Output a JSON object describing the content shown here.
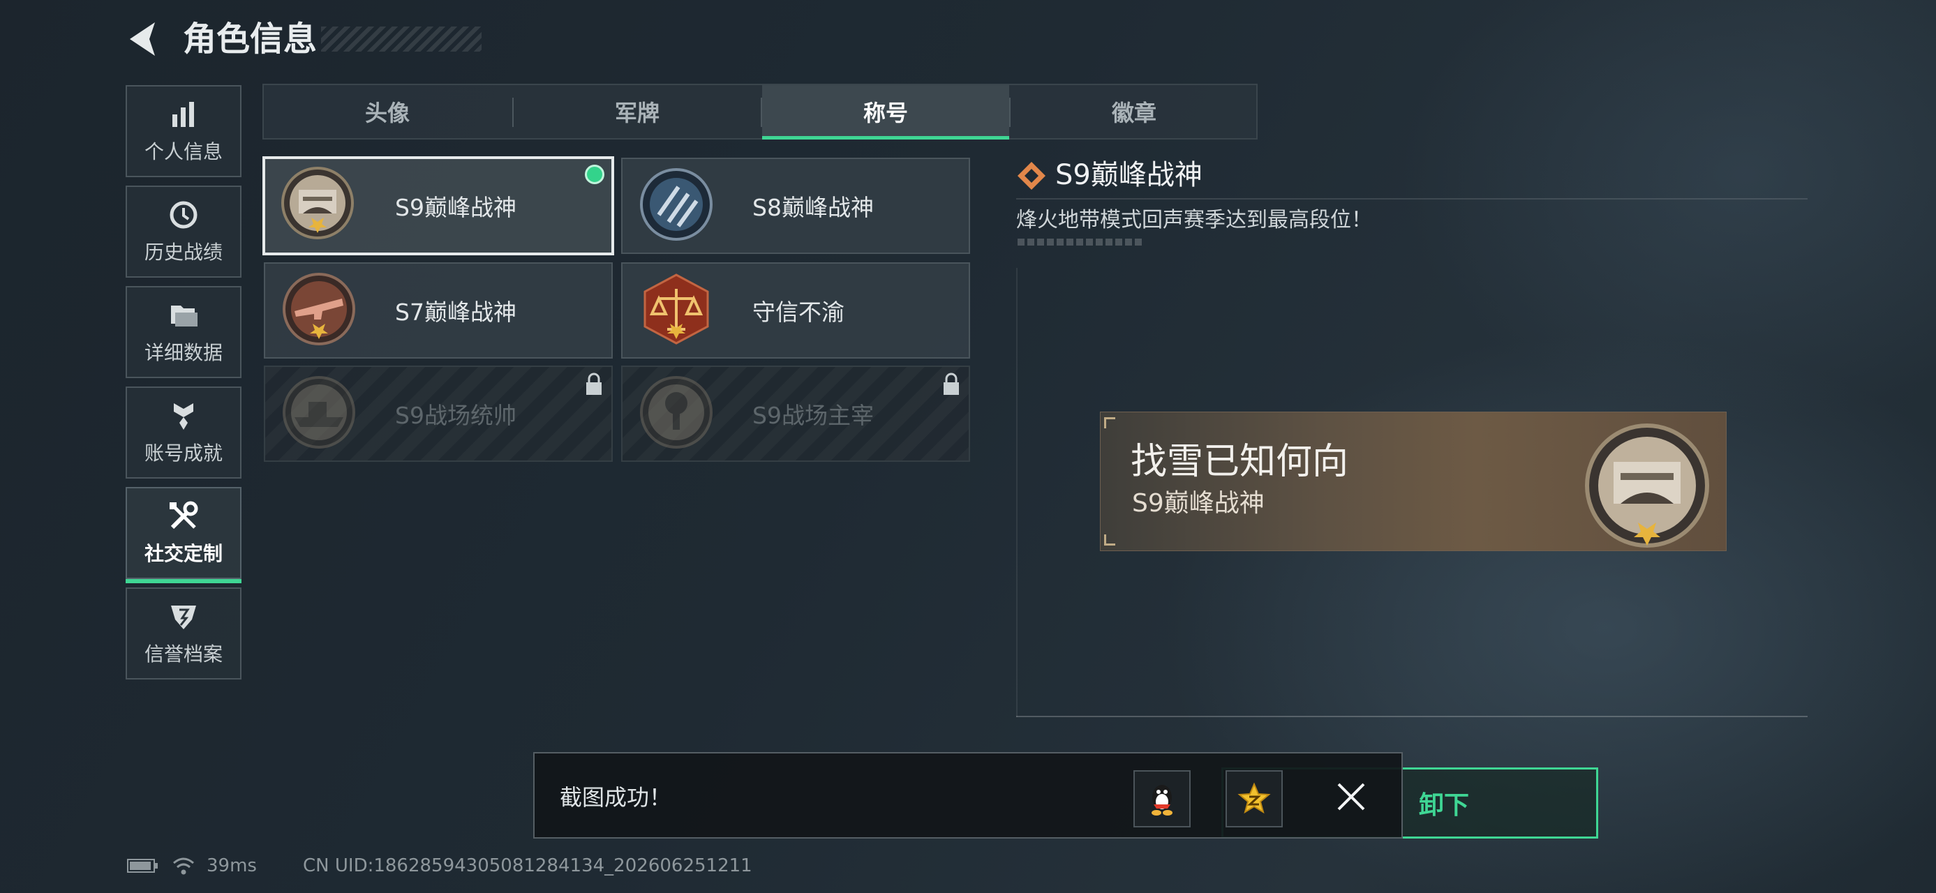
{
  "header": {
    "title": "角色信息"
  },
  "sidebar": {
    "items": [
      {
        "label": "个人信息",
        "icon": "bar-chart-icon"
      },
      {
        "label": "历史战绩",
        "icon": "history-clock-icon"
      },
      {
        "label": "详细数据",
        "icon": "folder-icon"
      },
      {
        "label": "账号成就",
        "icon": "achievement-icon"
      },
      {
        "label": "社交定制",
        "icon": "tools-icon",
        "active": true
      },
      {
        "label": "信誉档案",
        "icon": "credit-shield-icon"
      }
    ]
  },
  "tabs": [
    {
      "label": "头像"
    },
    {
      "label": "军牌"
    },
    {
      "label": "称号",
      "active": true
    },
    {
      "label": "徽章"
    }
  ],
  "titles": [
    {
      "name": "S9巅峰战神",
      "selected": true,
      "equipped": true,
      "locked": false
    },
    {
      "name": "S8巅峰战神",
      "selected": false,
      "equipped": false,
      "locked": false
    },
    {
      "name": "S7巅峰战神",
      "selected": false,
      "equipped": false,
      "locked": false
    },
    {
      "name": "守信不渝",
      "selected": false,
      "equipped": false,
      "locked": false
    },
    {
      "name": "S9战场统帅",
      "selected": false,
      "equipped": false,
      "locked": true
    },
    {
      "name": "S9战场主宰",
      "selected": false,
      "equipped": false,
      "locked": true
    }
  ],
  "detail": {
    "name": "S9巅峰战神",
    "description": "烽火地带模式回声赛季达到最高段位！"
  },
  "preview": {
    "player_name": "找雪已知何向",
    "title": "S9巅峰战神"
  },
  "action": {
    "unequip_label": "卸下"
  },
  "toast": {
    "message": "截图成功！",
    "share_qq_icon": "qq-penguin-icon",
    "share_qzone_icon": "qzone-star-icon"
  },
  "status": {
    "ping": "39ms",
    "uid": "CN UID:1862859430508128413­4_202606251211"
  },
  "colors": {
    "accent": "#3fd694",
    "background": "#1f2a33"
  }
}
